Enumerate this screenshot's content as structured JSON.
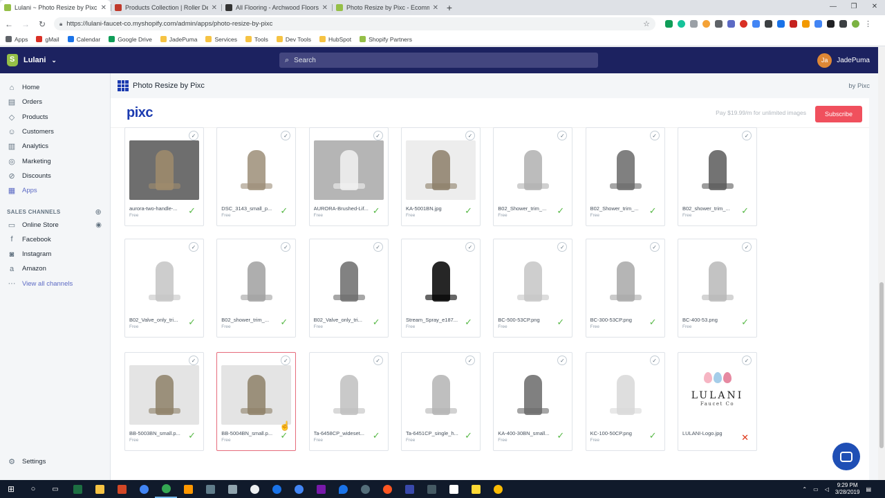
{
  "browser": {
    "tabs": [
      {
        "title": "Lulani ~ Photo Resize by Pixc ~ S",
        "color": "#95bf47",
        "active": true
      },
      {
        "title": "Products Collection | Roller Derb",
        "color": "#c0392b",
        "active": false
      },
      {
        "title": "All Flooring - Archwood Floors",
        "color": "#333333",
        "active": false
      },
      {
        "title": "Photo Resize by Pixc - Ecommer",
        "color": "#95bf47",
        "active": false
      }
    ],
    "new_tab": "+",
    "url": "https://lulani-faucet-co.myshopify.com/admin/apps/photo-resize-by-pixc",
    "bookmarks": [
      {
        "label": "Apps",
        "color": "#5f6368"
      },
      {
        "label": "gMail",
        "color": "#d93025"
      },
      {
        "label": "Calendar",
        "color": "#1a73e8"
      },
      {
        "label": "Google Drive",
        "color": "#0f9d58"
      },
      {
        "label": "JadePuma",
        "color": "#f6c343"
      },
      {
        "label": "Services",
        "color": "#f6c343"
      },
      {
        "label": "Tools",
        "color": "#f6c343"
      },
      {
        "label": "Dev Tools",
        "color": "#f6c343"
      },
      {
        "label": "HubSpot",
        "color": "#f6c343"
      },
      {
        "label": "Shopify Partners",
        "color": "#95bf47"
      }
    ]
  },
  "topbar": {
    "store_name": "Lulani",
    "search_placeholder": "Search",
    "user_initials": "Ja",
    "user_name": "JadePuma"
  },
  "sidebar": {
    "items": [
      {
        "label": "Home",
        "icon": "home-icon",
        "glyph": "⌂"
      },
      {
        "label": "Orders",
        "icon": "orders-icon",
        "glyph": "▤"
      },
      {
        "label": "Products",
        "icon": "tag-icon",
        "glyph": "◇"
      },
      {
        "label": "Customers",
        "icon": "customers-icon",
        "glyph": "☺"
      },
      {
        "label": "Analytics",
        "icon": "analytics-icon",
        "glyph": "▥"
      },
      {
        "label": "Marketing",
        "icon": "marketing-icon",
        "glyph": "◎"
      },
      {
        "label": "Discounts",
        "icon": "discount-icon",
        "glyph": "⊘"
      },
      {
        "label": "Apps",
        "icon": "apps-icon",
        "glyph": "▦"
      }
    ],
    "sales_channels_heading": "SALES CHANNELS",
    "channels": [
      {
        "label": "Online Store",
        "icon": "store-icon",
        "glyph": "▭"
      },
      {
        "label": "Facebook",
        "icon": "facebook-icon",
        "glyph": "f"
      },
      {
        "label": "Instagram",
        "icon": "instagram-icon",
        "glyph": "◙"
      },
      {
        "label": "Amazon",
        "icon": "amazon-icon",
        "glyph": "a"
      },
      {
        "label": "View all channels",
        "icon": "more-icon",
        "glyph": "···"
      }
    ],
    "settings_label": "Settings"
  },
  "app": {
    "title": "Photo Resize by Pixc",
    "by": "by Pixc",
    "logo_text": "pixc",
    "pay_text": "Pay $19.99/m for unlimited images",
    "subscribe_label": "Subscribe"
  },
  "images": [
    {
      "name": "aurora-two-handle-...",
      "status": "Free",
      "ok": true,
      "bg": "#6e6e6e",
      "fg": "#a08c6c"
    },
    {
      "name": "DSC_3143_small_p...",
      "status": "Free",
      "ok": true,
      "bg": "#ffffff",
      "fg": "#9c8e78"
    },
    {
      "name": "AURORA-Brushed-Lif...",
      "status": "Free",
      "ok": true,
      "bg": "#b5b5b5",
      "fg": "#f2f2f2"
    },
    {
      "name": "KA-5001BN.jpg",
      "status": "Free",
      "ok": true,
      "bg": "#ededed",
      "fg": "#8c7e68"
    },
    {
      "name": "B02_Shower_trim_...",
      "status": "Free",
      "ok": true,
      "bg": "#ffffff",
      "fg": "#b0b0b0"
    },
    {
      "name": "B02_Shower_trim_...",
      "status": "Free",
      "ok": true,
      "bg": "#ffffff",
      "fg": "#6a6a6a"
    },
    {
      "name": "B02_shower_trim_...",
      "status": "Free",
      "ok": true,
      "bg": "#ffffff",
      "fg": "#5a5a5a"
    },
    {
      "name": "B02_Valve_only_tri...",
      "status": "Free",
      "ok": true,
      "bg": "#ffffff",
      "fg": "#c4c4c4"
    },
    {
      "name": "B02_shower_trim_...",
      "status": "Free",
      "ok": true,
      "bg": "#ffffff",
      "fg": "#a0a0a0"
    },
    {
      "name": "B02_Valve_only_tri...",
      "status": "Free",
      "ok": true,
      "bg": "#ffffff",
      "fg": "#6c6c6c"
    },
    {
      "name": "Stream_Spray_e187...",
      "status": "Free",
      "ok": true,
      "bg": "#ffffff",
      "fg": "#000000"
    },
    {
      "name": "BC-500-53CP.png",
      "status": "Free",
      "ok": true,
      "bg": "#ffffff",
      "fg": "#c6c6c6"
    },
    {
      "name": "BC-300-53CP.png",
      "status": "Free",
      "ok": true,
      "bg": "#ffffff",
      "fg": "#a8a8a8"
    },
    {
      "name": "BC-400-53.png",
      "status": "Free",
      "ok": true,
      "bg": "#ffffff",
      "fg": "#b8b8b8"
    },
    {
      "name": "BB-5003BN_small.p...",
      "status": "Free",
      "ok": true,
      "bg": "#e4e4e4",
      "fg": "#8e8168"
    },
    {
      "name": "BB-5004BN_small.p...",
      "status": "Free",
      "ok": true,
      "bg": "#e4e4e4",
      "fg": "#8e8168"
    },
    {
      "name": "Ta-6458CP_wideset...",
      "status": "Free",
      "ok": true,
      "bg": "#ffffff",
      "fg": "#c0c0c0"
    },
    {
      "name": "Ta-6451CP_single_h...",
      "status": "Free",
      "ok": true,
      "bg": "#ffffff",
      "fg": "#b4b4b4"
    },
    {
      "name": "KA-400-30BN_small...",
      "status": "Free",
      "ok": true,
      "bg": "#ffffff",
      "fg": "#6a6a6a"
    },
    {
      "name": "KC-100-50CP.png",
      "status": "Free",
      "ok": true,
      "bg": "#ffffff",
      "fg": "#d8d8d8"
    },
    {
      "name": "LULANI-Logo.jpg",
      "status": "",
      "ok": false,
      "bg": "#ffffff",
      "fg": "#333333",
      "logo_lines": [
        "LULANI",
        "Faucet Co"
      ]
    }
  ],
  "taskbar": {
    "time": "9:29 PM",
    "date": "3/28/2019"
  }
}
